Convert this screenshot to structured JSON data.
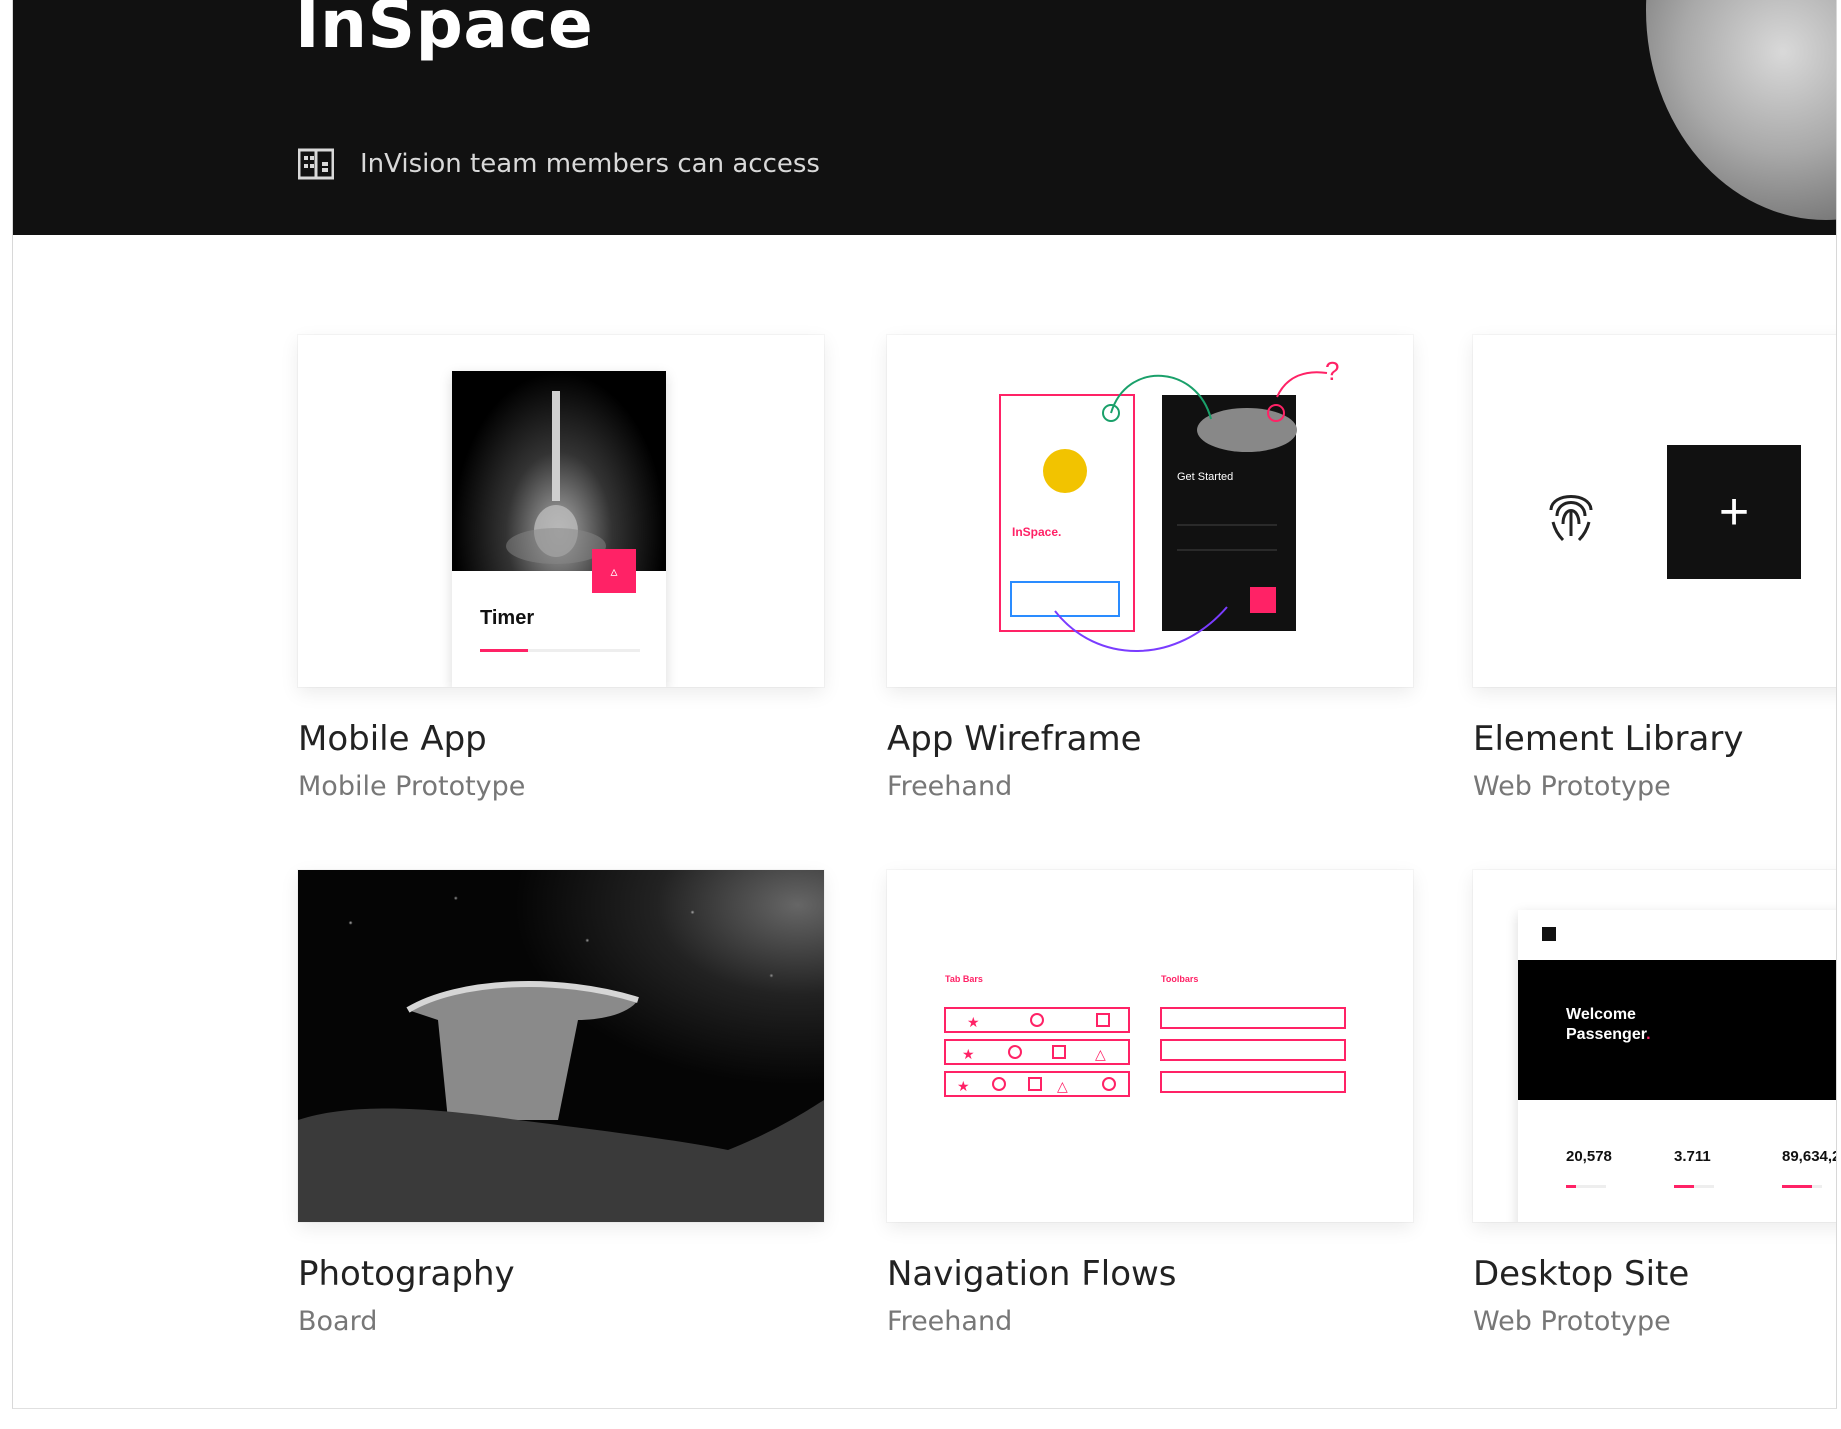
{
  "header": {
    "title": "InSpace",
    "access_icon": "building-icon",
    "access_text": "InVision team members can access"
  },
  "colors": {
    "header_bg": "#111111",
    "accent": "#ff2266",
    "card_title": "#222222",
    "card_subtitle": "#777777"
  },
  "projects": [
    {
      "title": "Mobile App",
      "subtitle": "Mobile Prototype",
      "thumbnail": {
        "label": "Timer",
        "progress": 0.3
      }
    },
    {
      "title": "App Wireframe",
      "subtitle": "Freehand",
      "thumbnail": {
        "screen1_title": "InSpace.",
        "screen2_title": "Get Started"
      }
    },
    {
      "title": "Element Library",
      "subtitle": "Web Prototype",
      "thumbnail": {
        "icon": "fingerprint-icon",
        "add_symbol": "+"
      }
    },
    {
      "title": "Photography",
      "subtitle": "Board"
    },
    {
      "title": "Navigation Flows",
      "subtitle": "Freehand",
      "thumbnail": {
        "tab_bars_label": "Tab Bars",
        "toolbars_label": "Toolbars"
      }
    },
    {
      "title": "Desktop Site",
      "subtitle": "Web Prototype",
      "thumbnail": {
        "hero_text": [
          "Welcome",
          "Passenger"
        ],
        "stats": [
          {
            "value": "20,578",
            "progress": 0.25
          },
          {
            "value": "3.711",
            "progress": 0.5
          },
          {
            "value": "89,634,2",
            "progress": 0.75
          }
        ]
      }
    }
  ]
}
